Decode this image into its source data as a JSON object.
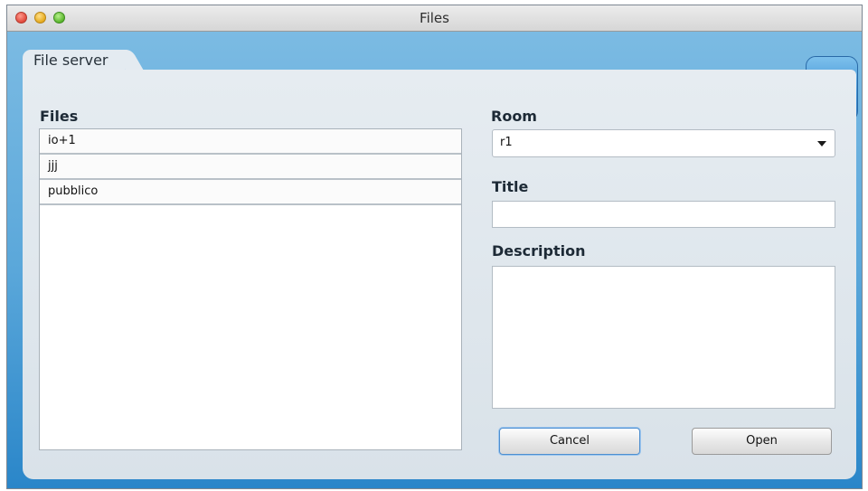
{
  "window": {
    "title": "Files"
  },
  "tab": {
    "label": "File server"
  },
  "files": {
    "label": "Files",
    "items": [
      "io+1",
      "jjj",
      "pubblico"
    ]
  },
  "room": {
    "label": "Room",
    "selected": "r1"
  },
  "title_field": {
    "label": "Title",
    "value": ""
  },
  "description_field": {
    "label": "Description",
    "value": ""
  },
  "buttons": {
    "cancel": "Cancel",
    "open": "Open"
  },
  "icons": {
    "app": "file-server-icon"
  },
  "colors": {
    "accent": "#3b8fd3",
    "panel": "#e4ebf1"
  }
}
